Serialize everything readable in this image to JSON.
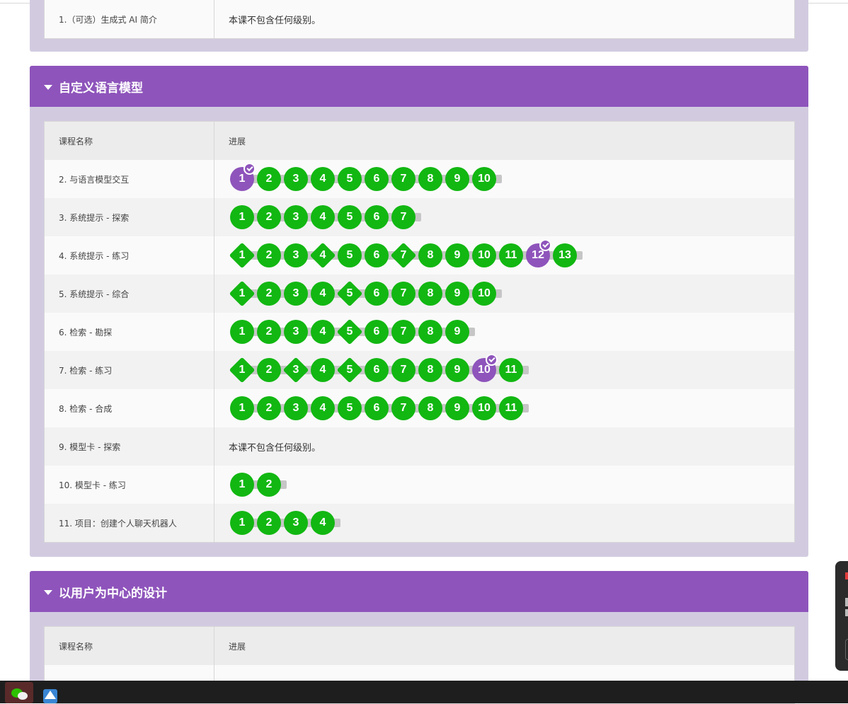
{
  "top_section": {
    "rows": [
      {
        "name": "1.（可选）生成式 AI 简介",
        "text": "本课不包含任何级别。"
      }
    ]
  },
  "section_lm": {
    "title": "自定义语言模型",
    "col_name": "课程名称",
    "col_progress": "进展",
    "rows": [
      {
        "name": "2. 与语言模型交互",
        "levels": [
          {
            "n": "1",
            "shape": "circle",
            "color": "purple",
            "check": true
          },
          {
            "n": "2",
            "shape": "circle",
            "color": "green"
          },
          {
            "n": "3",
            "shape": "circle",
            "color": "green"
          },
          {
            "n": "4",
            "shape": "circle",
            "color": "green"
          },
          {
            "n": "5",
            "shape": "circle",
            "color": "green"
          },
          {
            "n": "6",
            "shape": "circle",
            "color": "green"
          },
          {
            "n": "7",
            "shape": "circle",
            "color": "green"
          },
          {
            "n": "8",
            "shape": "circle",
            "color": "green"
          },
          {
            "n": "9",
            "shape": "circle",
            "color": "green"
          },
          {
            "n": "10",
            "shape": "circle",
            "color": "green"
          }
        ]
      },
      {
        "name": "3. 系统提示 - 探索",
        "levels": [
          {
            "n": "1",
            "shape": "circle",
            "color": "green"
          },
          {
            "n": "2",
            "shape": "circle",
            "color": "green"
          },
          {
            "n": "3",
            "shape": "circle",
            "color": "green"
          },
          {
            "n": "4",
            "shape": "circle",
            "color": "green"
          },
          {
            "n": "5",
            "shape": "circle",
            "color": "green"
          },
          {
            "n": "6",
            "shape": "circle",
            "color": "green"
          },
          {
            "n": "7",
            "shape": "circle",
            "color": "green"
          }
        ]
      },
      {
        "name": "4. 系统提示 - 练习",
        "levels": [
          {
            "n": "1",
            "shape": "diamond",
            "color": "green"
          },
          {
            "n": "2",
            "shape": "circle",
            "color": "green"
          },
          {
            "n": "3",
            "shape": "circle",
            "color": "green"
          },
          {
            "n": "4",
            "shape": "diamond",
            "color": "green"
          },
          {
            "n": "5",
            "shape": "circle",
            "color": "green"
          },
          {
            "n": "6",
            "shape": "circle",
            "color": "green"
          },
          {
            "n": "7",
            "shape": "diamond",
            "color": "green"
          },
          {
            "n": "8",
            "shape": "circle",
            "color": "green"
          },
          {
            "n": "9",
            "shape": "circle",
            "color": "green"
          },
          {
            "n": "10",
            "shape": "circle",
            "color": "green"
          },
          {
            "n": "11",
            "shape": "circle",
            "color": "green"
          },
          {
            "n": "12",
            "shape": "circle",
            "color": "purple",
            "check": true
          },
          {
            "n": "13",
            "shape": "circle",
            "color": "green"
          }
        ]
      },
      {
        "name": "5. 系统提示 - 综合",
        "levels": [
          {
            "n": "1",
            "shape": "diamond",
            "color": "green"
          },
          {
            "n": "2",
            "shape": "circle",
            "color": "green"
          },
          {
            "n": "3",
            "shape": "circle",
            "color": "green"
          },
          {
            "n": "4",
            "shape": "circle",
            "color": "green"
          },
          {
            "n": "5",
            "shape": "diamond",
            "color": "green"
          },
          {
            "n": "6",
            "shape": "circle",
            "color": "green"
          },
          {
            "n": "7",
            "shape": "circle",
            "color": "green"
          },
          {
            "n": "8",
            "shape": "circle",
            "color": "green"
          },
          {
            "n": "9",
            "shape": "circle",
            "color": "green"
          },
          {
            "n": "10",
            "shape": "circle",
            "color": "green"
          }
        ]
      },
      {
        "name": "6. 检索 - 勘探",
        "levels": [
          {
            "n": "1",
            "shape": "circle",
            "color": "green"
          },
          {
            "n": "2",
            "shape": "circle",
            "color": "green"
          },
          {
            "n": "3",
            "shape": "circle",
            "color": "green"
          },
          {
            "n": "4",
            "shape": "circle",
            "color": "green"
          },
          {
            "n": "5",
            "shape": "diamond",
            "color": "green"
          },
          {
            "n": "6",
            "shape": "circle",
            "color": "green"
          },
          {
            "n": "7",
            "shape": "circle",
            "color": "green"
          },
          {
            "n": "8",
            "shape": "circle",
            "color": "green"
          },
          {
            "n": "9",
            "shape": "circle",
            "color": "green"
          }
        ]
      },
      {
        "name": "7. 检索 - 练习",
        "levels": [
          {
            "n": "1",
            "shape": "diamond",
            "color": "green"
          },
          {
            "n": "2",
            "shape": "circle",
            "color": "green"
          },
          {
            "n": "3",
            "shape": "diamond",
            "color": "green"
          },
          {
            "n": "4",
            "shape": "circle",
            "color": "green"
          },
          {
            "n": "5",
            "shape": "diamond",
            "color": "green"
          },
          {
            "n": "6",
            "shape": "circle",
            "color": "green"
          },
          {
            "n": "7",
            "shape": "circle",
            "color": "green"
          },
          {
            "n": "8",
            "shape": "circle",
            "color": "green"
          },
          {
            "n": "9",
            "shape": "circle",
            "color": "green"
          },
          {
            "n": "10",
            "shape": "circle",
            "color": "purple",
            "check": true
          },
          {
            "n": "11",
            "shape": "circle",
            "color": "green"
          }
        ]
      },
      {
        "name": "8. 检索 - 合成",
        "levels": [
          {
            "n": "1",
            "shape": "circle",
            "color": "green"
          },
          {
            "n": "2",
            "shape": "circle",
            "color": "green"
          },
          {
            "n": "3",
            "shape": "circle",
            "color": "green"
          },
          {
            "n": "4",
            "shape": "circle",
            "color": "green"
          },
          {
            "n": "5",
            "shape": "circle",
            "color": "green"
          },
          {
            "n": "6",
            "shape": "circle",
            "color": "green"
          },
          {
            "n": "7",
            "shape": "circle",
            "color": "green"
          },
          {
            "n": "8",
            "shape": "circle",
            "color": "green"
          },
          {
            "n": "9",
            "shape": "circle",
            "color": "green"
          },
          {
            "n": "10",
            "shape": "circle",
            "color": "green"
          },
          {
            "n": "11",
            "shape": "circle",
            "color": "green"
          }
        ]
      },
      {
        "name": "9. 模型卡 - 探索",
        "text": "本课不包含任何级别。"
      },
      {
        "name": "10. 模型卡 - 练习",
        "levels": [
          {
            "n": "1",
            "shape": "circle",
            "color": "green"
          },
          {
            "n": "2",
            "shape": "circle",
            "color": "green"
          }
        ]
      },
      {
        "name": "11. 项目：创建个人聊天机器人",
        "levels": [
          {
            "n": "1",
            "shape": "circle",
            "color": "green"
          },
          {
            "n": "2",
            "shape": "circle",
            "color": "green"
          },
          {
            "n": "3",
            "shape": "circle",
            "color": "green"
          },
          {
            "n": "4",
            "shape": "circle",
            "color": "green"
          }
        ]
      }
    ]
  },
  "section_ucd": {
    "title": "以用户为中心的设计",
    "col_name": "课程名称",
    "col_progress": "进展"
  },
  "colors": {
    "accent": "#8e54bb",
    "complete": "#12b712",
    "section_bg": "#d2cbe0"
  },
  "taskbar": {
    "apps": [
      {
        "icon": "wechat-icon"
      },
      {
        "icon": "image-app-icon"
      }
    ]
  }
}
